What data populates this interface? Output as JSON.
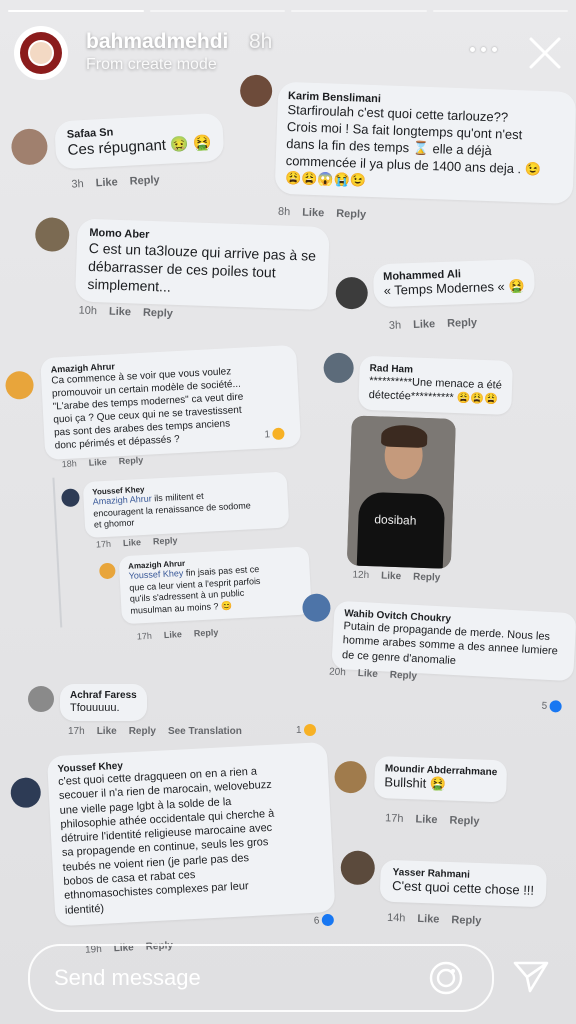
{
  "story": {
    "username": "bahmadmehdi",
    "time": "8h",
    "subtitle": "From create mode",
    "progress_segments": 4,
    "active_segment": 1
  },
  "comments": {
    "karim": {
      "name": "Karim Benslimani",
      "text": "Starfiroulah c'est quoi cette tarlouze??\nCrois moi ! Sa fait longtemps qu'ont n'est\ndans la fin des temps ⌛ elle a déjà\ncommencée il ya plus de 1400 ans  deja . 😉\n😩😩😱😭😉",
      "time": "8h",
      "like": "Like",
      "reply": "Reply"
    },
    "safaa": {
      "name": "Safaa Sn",
      "text": "Ces répugnant 🤢 🤮",
      "time": "3h",
      "like": "Like",
      "reply": "Reply"
    },
    "momo": {
      "name": "Momo Aber",
      "text": "C est un ta3louze qui arrive pas à se\ndébarrasser de ces poiles tout\nsimplement...",
      "time": "10h",
      "like": "Like",
      "reply": "Reply"
    },
    "mohammed": {
      "name": "Mohammed Ali",
      "text": "« Temps Modernes «  🤮",
      "time": "3h",
      "like": "Like",
      "reply": "Reply"
    },
    "amazigh1": {
      "name": "Amazigh Ahrur",
      "text": "Ca commence à se voir que vous voulez\npromouvoir un certain modèle de société...\n\"L'arabe des temps modernes\" ca veut dire\nquoi ça ? Que ceux qui ne se travestissent\npas sont des arabes des temps anciens\ndonc périmés et dépassés ?",
      "time": "18h",
      "like": "Like",
      "reply": "Reply",
      "reacts": "1"
    },
    "rad": {
      "name": "Rad Ham",
      "text": "**********Une menace a été\ndétectée********** 😩😩😩",
      "time": "12h",
      "like": "Like",
      "reply": "Reply",
      "shirt_text": "dosibah"
    },
    "youssef1": {
      "name": "Youssef Khey",
      "mention": "Amazigh Ahrur",
      "text": " ils militent et\nencouragent la renaissance de sodome\net ghomor",
      "time": "17h",
      "like": "Like",
      "reply": "Reply"
    },
    "amazigh2": {
      "name": "Amazigh Ahrur",
      "mention": "Youssef Khey",
      "text": " fin jsais pas est ce\nque ca leur vient a l'esprit parfois\nqu'ils s'adressent à un public\nmusulman au moins ? 😊",
      "time": "17h",
      "like": "Like",
      "reply": "Reply"
    },
    "wahib": {
      "name": "Wahib Ovitch Choukry",
      "text": "Putain de propagande de merde. Nous les\nhomme arabes somme a des annee lumiere\nde ce genre d'anomalie",
      "time": "20h",
      "like": "Like",
      "reply": "Reply",
      "reacts": "5"
    },
    "achraf": {
      "name": "Achraf Faress",
      "text": "Tfouuuuu.",
      "time": "17h",
      "like": "Like",
      "reply": "Reply",
      "translate": "See Translation",
      "reacts": "1"
    },
    "youssef2": {
      "name": "Youssef Khey",
      "text": "c'est quoi cette dragqueen on en a rien a\nsecouer il n'a rien de marocain, welovebuzz\nune vielle page lgbt à la solde de la\nphilosophie athée occidentale qui cherche à\ndétruire l'identité religieuse marocaine avec\nsa propagende en continue, seuls les gros\nteubés ne voient rien (je parle pas des\nbobos de casa et rabat ces\nethnomasochistes complexes par leur\nidentité)",
      "time": "19h",
      "like": "Like",
      "reply": "Reply",
      "reacts": "6"
    },
    "moundir": {
      "name": "Moundir Abderrahmane",
      "text": "Bullshit 🤮",
      "time": "17h",
      "like": "Like",
      "reply": "Reply"
    },
    "yasser": {
      "name": "Yasser Rahmani",
      "text": "C'est quoi cette chose !!!",
      "time": "14h",
      "like": "Like",
      "reply": "Reply"
    }
  },
  "footer": {
    "send_placeholder": "Send message"
  },
  "colors": {
    "bubble": "#f0f2f5",
    "link": "#385898",
    "meta": "#65676b",
    "fb_like": "#1877f2"
  }
}
